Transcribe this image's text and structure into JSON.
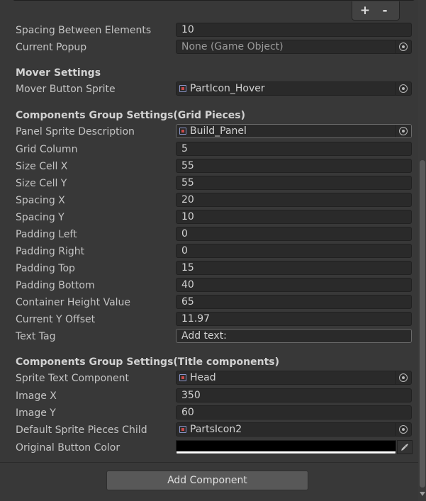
{
  "list_controls": {
    "plus": "+",
    "minus": "-"
  },
  "rows_top": {
    "spacing_between_elements": {
      "label": "Spacing Between Elements",
      "value": "10"
    },
    "current_popup": {
      "label": "Current Popup",
      "value": "None (Game Object)"
    }
  },
  "mover": {
    "header": "Mover Settings",
    "button_sprite": {
      "label": "Mover Button Sprite",
      "value": "PartIcon_Hover"
    }
  },
  "grid": {
    "header": "Components Group Settings(Grid Pieces)",
    "panel_sprite": {
      "label": "Panel Sprite Description",
      "value": "Build_Panel"
    },
    "rows": [
      {
        "label": "Grid Column",
        "value": "5"
      },
      {
        "label": "Size Cell X",
        "value": "55"
      },
      {
        "label": "Size Cell Y",
        "value": "55"
      },
      {
        "label": "Spacing X",
        "value": "20"
      },
      {
        "label": "Spacing Y",
        "value": "10"
      },
      {
        "label": "Padding Left",
        "value": "0"
      },
      {
        "label": "Padding Right",
        "value": "0"
      },
      {
        "label": "Padding Top",
        "value": "15"
      },
      {
        "label": "Padding Bottom",
        "value": "40"
      },
      {
        "label": "Container Height Value",
        "value": "65"
      },
      {
        "label": "Current Y Offset",
        "value": "11.97"
      }
    ],
    "text_tag": {
      "label": "Text Tag",
      "value": "Add text:"
    }
  },
  "title": {
    "header": "Components Group Settings(Title components)",
    "sprite_text": {
      "label": "Sprite Text Component",
      "value": "Head"
    },
    "image_x": {
      "label": "Image X",
      "value": "350"
    },
    "image_y": {
      "label": "Image Y",
      "value": "60"
    },
    "default_sprite": {
      "label": "Default Sprite Pieces Child",
      "value": "PartsIcon2"
    },
    "button_color": {
      "label": "Original Button Color",
      "color": "#000000"
    }
  },
  "add_component": "Add Component",
  "icons": {
    "object_picker": "circle-dot-icon",
    "sprite": "sprite-icon",
    "eyedropper": "eyedropper-icon"
  },
  "colors": {
    "background": "#383838",
    "field": "#2a2a2a"
  }
}
